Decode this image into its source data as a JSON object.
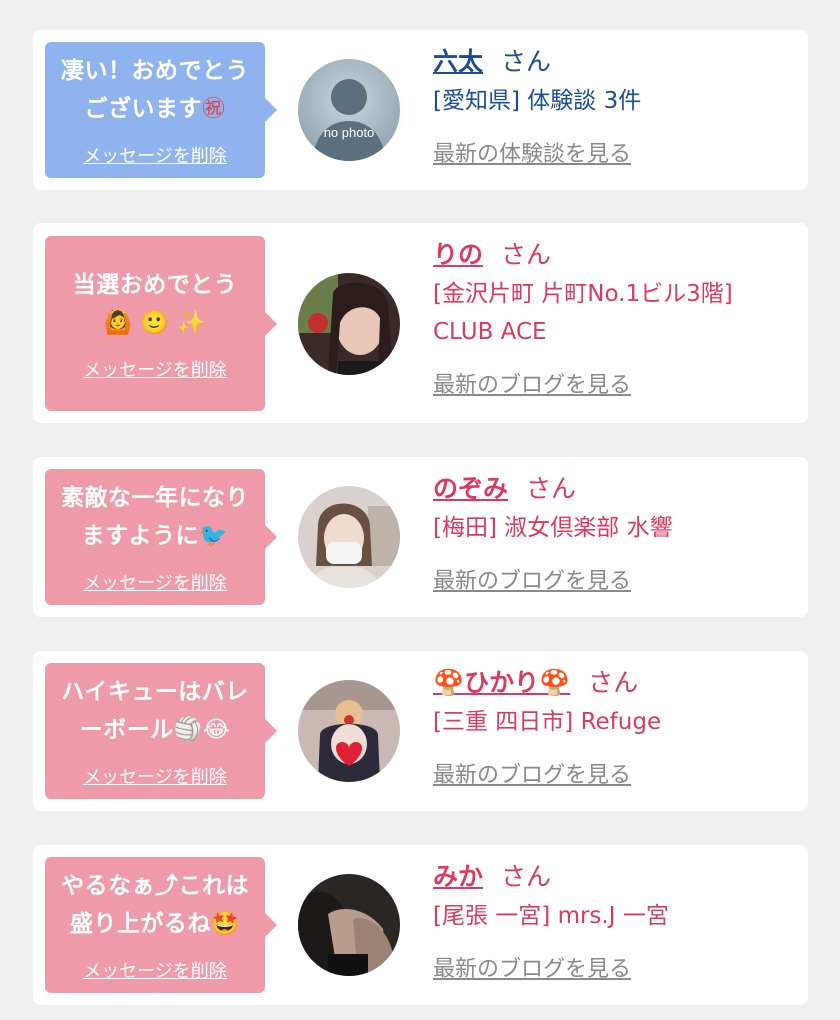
{
  "cards": [
    {
      "message": "凄い！おめでとうございます",
      "message_emoji": "㊗",
      "delete_label": "メッセージを削除",
      "avatar_text": "no photo",
      "name": "六太",
      "honorific": "さん",
      "detail": "[愛知県] 体験談 3件",
      "link": "最新の体験談を見る",
      "colors": {
        "bubble": "#8fb3ee",
        "text": "#1a4d9a"
      }
    },
    {
      "message": "当選おめでとう",
      "message_emoji": "🙆 🙂 ✨",
      "delete_label": "メッセージを削除",
      "name": "りの",
      "honorific": "さん",
      "detail": "[金沢片町 片町No.1ビル3階] CLUB ACE",
      "link": "最新のブログを見る",
      "colors": {
        "bubble": "#ee9aa9",
        "text": "#d83a60"
      }
    },
    {
      "message": "素敵な一年になりますように",
      "message_emoji": "🐦",
      "delete_label": "メッセージを削除",
      "name": "のぞみ",
      "honorific": "さん",
      "detail": "[梅田] 淑女倶楽部 水響",
      "link": "最新のブログを見る",
      "colors": {
        "bubble": "#ee9aa9",
        "text": "#d83a60"
      }
    },
    {
      "message": "ハイキューはバレーボール",
      "message_emoji": "🏐😂",
      "delete_label": "メッセージを削除",
      "name": "🍄ひかり🍄",
      "honorific": "さん",
      "detail": "[三重 四日市] Refuge",
      "link": "最新のブログを見る",
      "colors": {
        "bubble": "#ee9aa9",
        "text": "#d83a60"
      }
    },
    {
      "message": "やるなぁ⤴これは盛り上がるね",
      "message_emoji": "🤩",
      "delete_label": "メッセージを削除",
      "name": "みか",
      "honorific": "さん",
      "detail": "[尾張 一宮] mrs.J 一宮",
      "link": "最新のブログを見る",
      "colors": {
        "bubble": "#ee9aa9",
        "text": "#d83a60"
      }
    }
  ]
}
